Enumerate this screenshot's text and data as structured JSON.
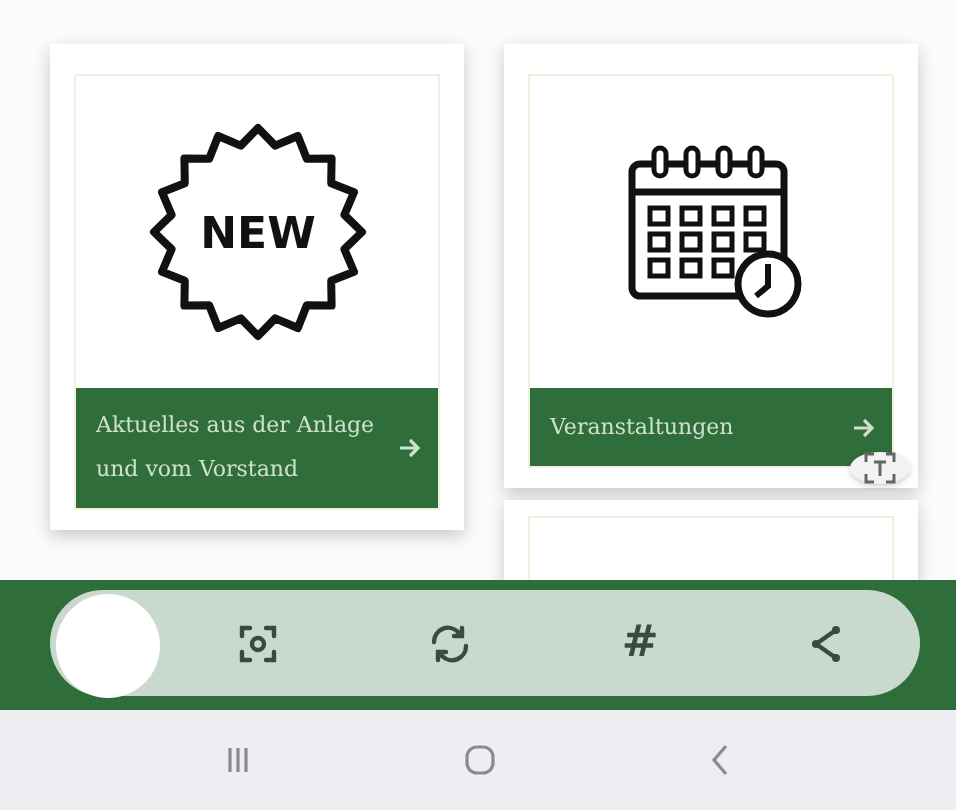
{
  "tiles": [
    {
      "kind": "news",
      "badge_text": "NEW",
      "label": "Aktuelles aus der Anlage und vom Vorstand"
    },
    {
      "kind": "calendar",
      "label": "Veranstaltungen"
    }
  ],
  "toolbar": {
    "items": [
      {
        "kind": "scan"
      },
      {
        "kind": "rotate"
      },
      {
        "kind": "text",
        "glyph": "#"
      },
      {
        "kind": "share"
      }
    ]
  },
  "nav_bar": {
    "items": [
      {
        "kind": "recents"
      },
      {
        "kind": "home"
      },
      {
        "kind": "back"
      }
    ]
  }
}
